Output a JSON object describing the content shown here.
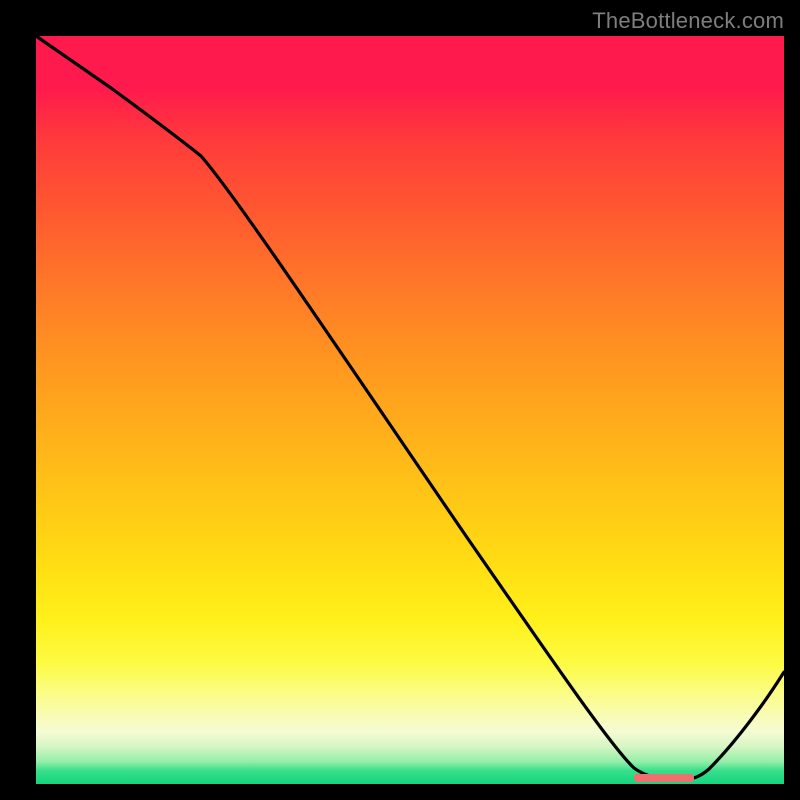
{
  "watermark": "TheBottleneck.com",
  "chart_data": {
    "type": "line",
    "title": "",
    "xlabel": "",
    "ylabel": "",
    "xlim": [
      0,
      100
    ],
    "ylim": [
      0,
      100
    ],
    "series": [
      {
        "name": "curve",
        "x": [
          0,
          10,
          22,
          40,
          58,
          73,
          80,
          86,
          90,
          100
        ],
        "y": [
          100,
          93,
          84,
          58,
          32,
          10,
          1.5,
          0.5,
          1.5,
          15
        ]
      }
    ],
    "optimal_marker": {
      "x_start": 80,
      "x_end": 88,
      "y": 0.5
    },
    "colors": {
      "curve": "#000000",
      "marker": "#ef6e6e",
      "gradient_top": "#ff1a4d",
      "gradient_bottom": "#12d57d",
      "frame": "#000000"
    }
  }
}
